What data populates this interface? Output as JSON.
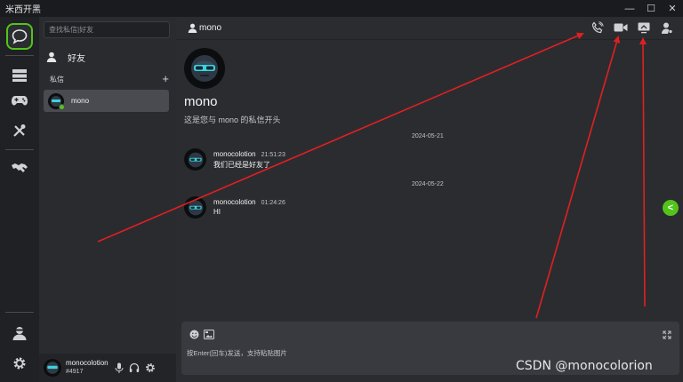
{
  "window": {
    "title": "米西开黑",
    "minimize": "—",
    "maximize": "☐",
    "close": "✕"
  },
  "rail": {
    "items": [
      "chat-bubble-icon",
      "server-icon",
      "gamepad-icon",
      "tools-icon",
      "handshake-icon"
    ],
    "bottom": [
      "user-profile-icon",
      "settings-gear-icon"
    ]
  },
  "panel": {
    "search_placeholder": "查找私信|好友",
    "friends_label": "好友",
    "dm_header": "私信",
    "dm_add": "+",
    "dm_items": [
      {
        "name": "mono",
        "online": true
      }
    ],
    "user": {
      "name": "monocolotion",
      "tag": "#4917"
    }
  },
  "chat": {
    "header_title": "mono",
    "intro_name": "mono",
    "intro_desc": "这是您与 mono 的私信开头",
    "groups": [
      {
        "date": "2024-05-21",
        "author": "monocolotion",
        "time": "21:51:23",
        "text": "我们已经是好友了"
      },
      {
        "date": "2024-05-22",
        "author": "monocolotion",
        "time": "01:24:26",
        "text": "HI"
      }
    ],
    "side_button": "<",
    "composer_placeholder": "按Enter(回车)发送，支持粘贴图片"
  },
  "colors": {
    "accent": "#52c41a",
    "annotation_arrow": "#e02020",
    "background": "#2b2c30"
  },
  "watermark": "CSDN @monocolorion"
}
